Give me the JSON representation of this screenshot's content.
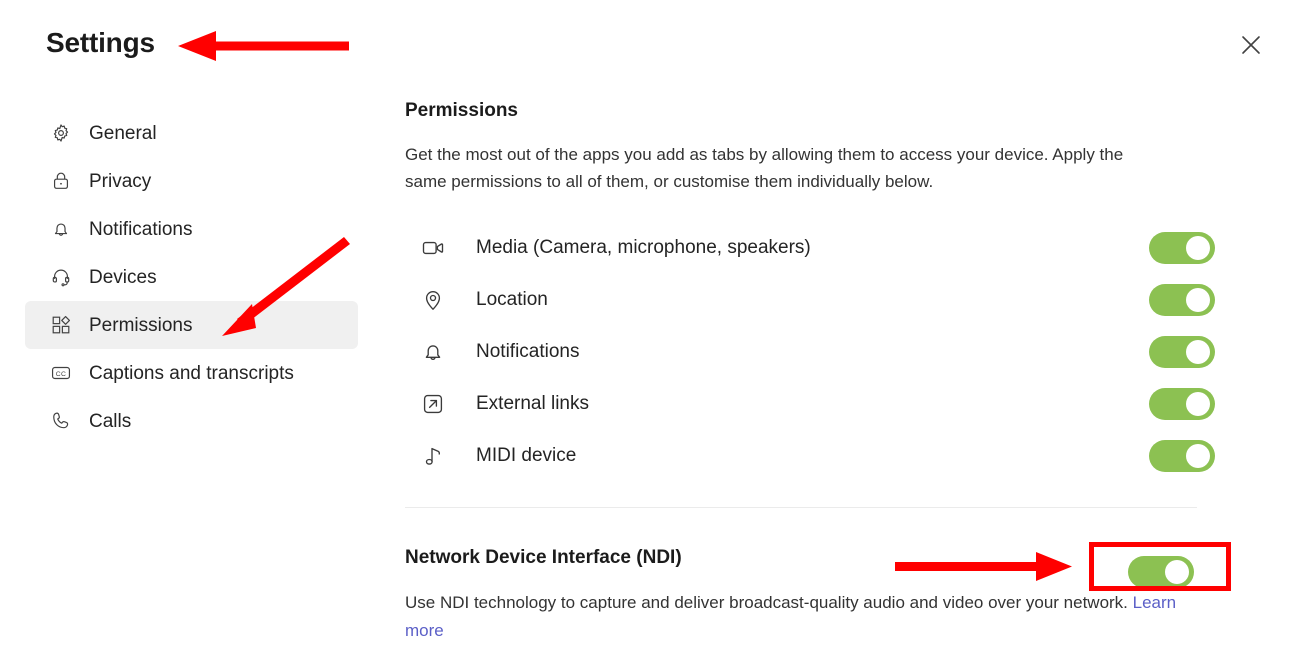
{
  "window": {
    "title": "Settings",
    "close_icon": "close-icon",
    "background": "#ffffff"
  },
  "sidebar": {
    "items": [
      {
        "label": "General",
        "icon": "gear-icon",
        "selected": false
      },
      {
        "label": "Privacy",
        "icon": "lock-icon",
        "selected": false
      },
      {
        "label": "Notifications",
        "icon": "bell-icon",
        "selected": false
      },
      {
        "label": "Devices",
        "icon": "headset-icon",
        "selected": false
      },
      {
        "label": "Permissions",
        "icon": "apps-grid-icon",
        "selected": true
      },
      {
        "label": "Captions and transcripts",
        "icon": "closed-caption-icon",
        "selected": false
      },
      {
        "label": "Calls",
        "icon": "phone-icon",
        "selected": false
      }
    ],
    "selected_background": "#f0f0f0"
  },
  "main": {
    "heading": "Permissions",
    "description": "Get the most out of the apps you add as tabs by allowing them to access your device. Apply the same permissions to all of them, or customise them individually below.",
    "permissions": [
      {
        "label": "Media (Camera, microphone, speakers)",
        "icon": "video-camera-icon",
        "toggle_on": true
      },
      {
        "label": "Location",
        "icon": "location-pin-icon",
        "toggle_on": true
      },
      {
        "label": "Notifications",
        "icon": "bell-icon",
        "toggle_on": true
      },
      {
        "label": "External links",
        "icon": "external-link-icon",
        "toggle_on": true
      },
      {
        "label": "MIDI device",
        "icon": "music-note-icon",
        "toggle_on": true
      }
    ],
    "ndi": {
      "title": "Network Device Interface (NDI)",
      "description_before_link": "Use NDI technology to capture and deliver broadcast-quality audio and video over your network. ",
      "link_label": "Learn more",
      "toggle_on": true
    }
  },
  "colors": {
    "toggle_on": "#8cc152",
    "toggle_knob": "#ffffff",
    "link": "#5b5fc7",
    "annotation": "#ff0000",
    "text_primary": "#242424",
    "text_heading": "#1b1b1b",
    "divider": "#ebebeb"
  },
  "annotations": {
    "arrow_to_title": "red-arrow-pointing-left-at-settings-title",
    "arrow_to_permissions": "red-arrow-pointing-down-left-at-permissions-item",
    "arrow_to_ndi_toggle": "red-arrow-pointing-right-at-ndi-toggle",
    "highlight_ndi_toggle": "red-rectangle-around-ndi-toggle"
  }
}
